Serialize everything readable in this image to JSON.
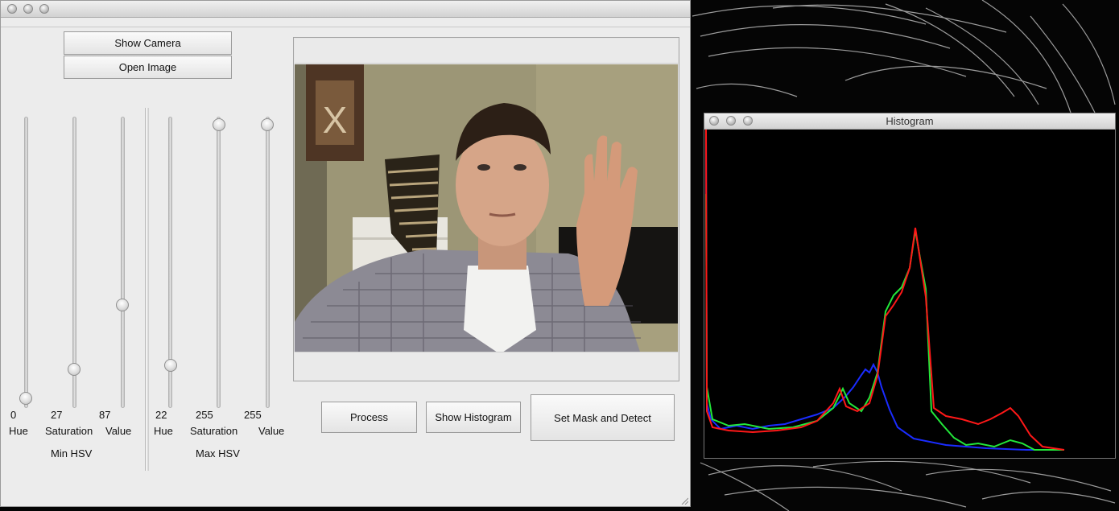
{
  "main_window": {
    "buttons": {
      "show_camera": "Show Camera",
      "open_image": "Open Image",
      "process": "Process",
      "show_histogram": "Show Histogram",
      "set_mask": "Set Mask and Detect"
    },
    "min_hsv": {
      "group_label": "Min HSV",
      "sliders": [
        {
          "label": "Hue",
          "value": "0",
          "fraction": 0.0
        },
        {
          "label": "Saturation",
          "value": "27",
          "fraction": 0.106
        },
        {
          "label": "Value",
          "value": "87",
          "fraction": 0.341
        }
      ]
    },
    "max_hsv": {
      "group_label": "Max HSV",
      "sliders": [
        {
          "label": "Hue",
          "value": "22",
          "fraction": 0.122
        },
        {
          "label": "Saturation",
          "value": "255",
          "fraction": 1.0
        },
        {
          "label": "Value",
          "value": "255",
          "fraction": 1.0
        }
      ]
    }
  },
  "histogram_window": {
    "title": "Histogram"
  },
  "colors": {
    "window_bg": "#ececec",
    "hist_blue": "#1a2cff",
    "hist_green": "#22e83a",
    "hist_red": "#ff1818"
  }
}
